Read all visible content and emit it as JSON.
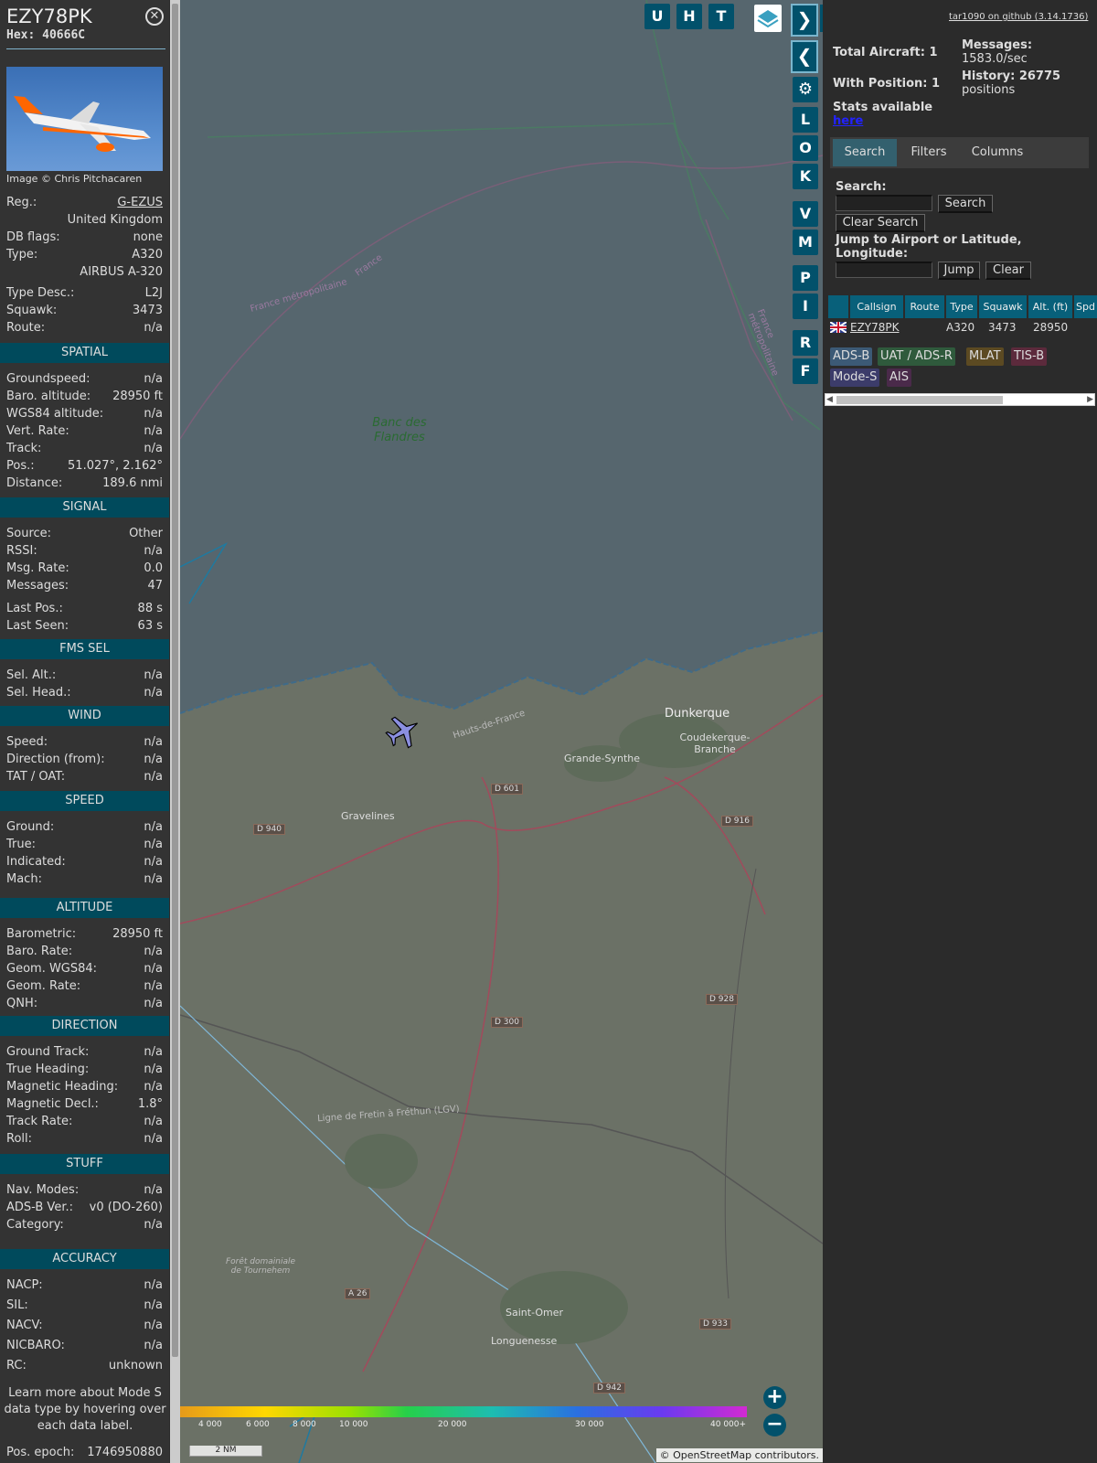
{
  "aircraft": {
    "callsign": "EZY78PK",
    "hex": "Hex: 40666C",
    "image_credit": "Image © Chris Pitchacaren",
    "details": [
      {
        "label": "Reg.:",
        "value": "G-EZUS"
      },
      {
        "label": "",
        "value": "United Kingdom"
      },
      {
        "label": "DB flags:",
        "value": "none"
      },
      {
        "label": "Type:",
        "value": "A320"
      },
      {
        "label": "",
        "value": "AIRBUS A-320"
      },
      {
        "label": "Type Desc.:",
        "value": "L2J"
      },
      {
        "label": "Squawk:",
        "value": "3473"
      },
      {
        "label": "Route:",
        "value": "n/a"
      }
    ]
  },
  "sections": [
    {
      "title": "SPATIAL",
      "rows": [
        {
          "label": "Groundspeed:",
          "value": "n/a"
        },
        {
          "label": "Baro. altitude:",
          "value": "28950 ft"
        },
        {
          "label": "WGS84 altitude:",
          "value": "n/a"
        },
        {
          "label": "Vert. Rate:",
          "value": "n/a"
        },
        {
          "label": "Track:",
          "value": "n/a"
        },
        {
          "label": "Pos.:",
          "value": "51.027°, 2.162°"
        },
        {
          "label": "Distance:",
          "value": "189.6 nmi"
        }
      ]
    },
    {
      "title": "SIGNAL",
      "rows": [
        {
          "label": "Source:",
          "value": "Other"
        },
        {
          "label": "RSSI:",
          "value": "n/a"
        },
        {
          "label": "Msg. Rate:",
          "value": "0.0"
        },
        {
          "label": "Messages:",
          "value": "47"
        },
        {
          "label": "Last Pos.:",
          "value": "88 s"
        },
        {
          "label": "Last Seen:",
          "value": "63 s"
        }
      ]
    },
    {
      "title": "FMS SEL",
      "rows": [
        {
          "label": "Sel. Alt.:",
          "value": "n/a"
        },
        {
          "label": "Sel. Head.:",
          "value": "n/a"
        }
      ]
    },
    {
      "title": "WIND",
      "rows": [
        {
          "label": "Speed:",
          "value": "n/a"
        },
        {
          "label": "Direction (from):",
          "value": "n/a"
        },
        {
          "label": "TAT / OAT:",
          "value": "n/a"
        }
      ]
    },
    {
      "title": "SPEED",
      "rows": [
        {
          "label": "Ground:",
          "value": "n/a"
        },
        {
          "label": "True:",
          "value": "n/a"
        },
        {
          "label": "Indicated:",
          "value": "n/a"
        },
        {
          "label": "Mach:",
          "value": "n/a"
        }
      ]
    },
    {
      "title": "ALTITUDE",
      "rows": [
        {
          "label": "Barometric:",
          "value": "28950 ft"
        },
        {
          "label": "Baro. Rate:",
          "value": "n/a"
        },
        {
          "label": "Geom. WGS84:",
          "value": "n/a"
        },
        {
          "label": "Geom. Rate:",
          "value": "n/a"
        },
        {
          "label": "QNH:",
          "value": "n/a"
        }
      ]
    },
    {
      "title": "DIRECTION",
      "rows": [
        {
          "label": "Ground Track:",
          "value": "n/a"
        },
        {
          "label": "True Heading:",
          "value": "n/a"
        },
        {
          "label": "Magnetic Heading:",
          "value": "n/a"
        },
        {
          "label": "Magnetic Decl.:",
          "value": "1.8°"
        },
        {
          "label": "Track Rate:",
          "value": "n/a"
        },
        {
          "label": "Roll:",
          "value": "n/a"
        }
      ]
    },
    {
      "title": "STUFF",
      "rows": [
        {
          "label": "Nav. Modes:",
          "value": "n/a"
        },
        {
          "label": "ADS-B Ver.:",
          "value": "v0 (DO-260)"
        },
        {
          "label": "Category:",
          "value": "n/a"
        }
      ]
    },
    {
      "title": "ACCURACY",
      "rows": [
        {
          "label": "NACP:",
          "value": "n/a"
        },
        {
          "label": "SIL:",
          "value": "n/a"
        },
        {
          "label": "NACV:",
          "value": "n/a"
        },
        {
          "label": "NICBARO:",
          "value": "n/a"
        },
        {
          "label": "RC:",
          "value": "unknown"
        }
      ]
    }
  ],
  "footer_note": "Learn more about Mode S data type by hovering over each data label.",
  "pos_epoch": {
    "label": "Pos. epoch:",
    "value": "1746950880"
  },
  "map_controls": [
    "U",
    "H",
    "T"
  ],
  "side_buttons": [
    "L",
    "O",
    "K",
    "V",
    "M",
    "P",
    "I",
    "R",
    "F"
  ],
  "map_labels": {
    "banc": "Banc des Flandres",
    "france1": "France métropolitaine",
    "france2": "France",
    "france3": "France métropolitaine",
    "dunkerque": "Dunkerque",
    "coudekerque": "Coudekerque-Branche",
    "grande_synthe": "Grande-Synthe",
    "gravelines": "Gravelines",
    "saint_omer": "Saint-Omer",
    "longuenesse": "Longuenesse",
    "hauts": "Hauts-de-France",
    "foret": "Forêt domainiale de Tournehem",
    "ligne": "Ligne de Fretin à Fréthun (LGV)",
    "d601": "D 601",
    "d940": "D 940",
    "d916": "D 916",
    "d300": "D 300",
    "d928": "D 928",
    "d933": "D 933",
    "a26": "A 26",
    "d942": "D 942"
  },
  "scale": {
    "ticks": [
      "4 000",
      "6 000",
      "8 000",
      "10 000",
      "20 000",
      "30 000",
      "40 000+"
    ],
    "bar": "2 NM"
  },
  "attribution": "© OpenStreetMap contributors.",
  "stats": {
    "version": "tar1090 on github (3.14.1736)",
    "total_aircraft": "Total Aircraft: 1",
    "with_position": "With Position: 1",
    "messages_label": "Messages:",
    "messages_value": "1583.0/sec",
    "history_label": "History: 26775",
    "history_value": "positions",
    "stats_available": "Stats available",
    "here": "here"
  },
  "tabs": [
    "Search",
    "Filters",
    "Columns"
  ],
  "search": {
    "label": "Search:",
    "search_button": "Search",
    "clear_button": "Clear Search",
    "jump_label": "Jump to Airport or Latitude, Longitude:",
    "jump_button": "Jump",
    "clear2_button": "Clear"
  },
  "table": {
    "headers": [
      "Callsign",
      "Route",
      "Type",
      "Squawk",
      "Alt. (ft)",
      "Spd"
    ],
    "rows": [
      {
        "callsign": "EZY78PK",
        "route": "",
        "type": "A320",
        "squawk": "3473",
        "alt": "28950"
      }
    ]
  },
  "sources": [
    {
      "label": "ADS-B",
      "color": "#3c5a76"
    },
    {
      "label": "UAT / ADS-R",
      "color": "#2f5a3c"
    },
    {
      "label": "MLAT",
      "color": "#5c4a22"
    },
    {
      "label": "TIS-B",
      "color": "#5c2a3c"
    },
    {
      "label": "Mode-S",
      "color": "#3c3c6a"
    },
    {
      "label": "AIS",
      "color": "#4a2a4a"
    }
  ]
}
